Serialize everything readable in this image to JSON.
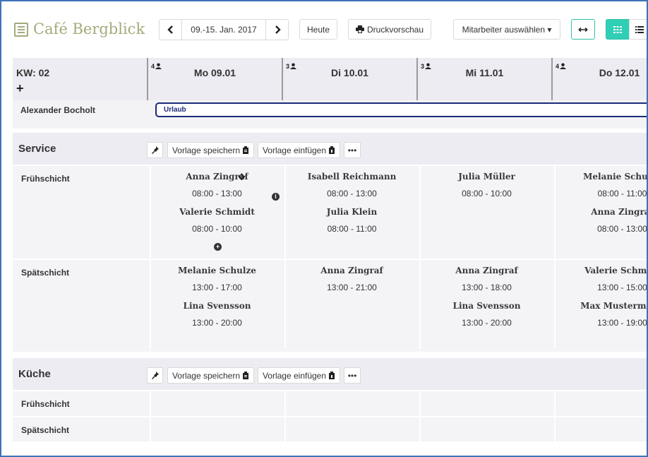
{
  "app": {
    "title": "Café Bergblick"
  },
  "toolbar": {
    "prev_icon": "chevron-left-icon",
    "next_icon": "chevron-right-icon",
    "prev_label": "‹",
    "next_label": "›",
    "date_range": "09.-15. Jan. 2017",
    "today_label": "Heute",
    "print_label": "Druckvorschau",
    "employee_select_label": "Mitarbeiter auswählen ▾",
    "expand_label": "↔",
    "accent_color": "#2fcfb5"
  },
  "calendar": {
    "week_label": "KW: 02",
    "add_label": "+",
    "days": [
      {
        "count": "4",
        "label": "Mo 09.01"
      },
      {
        "count": "3",
        "label": "Di 10.01"
      },
      {
        "count": "3",
        "label": "Mi 11.01"
      },
      {
        "count": "4",
        "label": "Do 12.01"
      }
    ],
    "absence_row": {
      "employee": "Alexander Bocholt",
      "absence": "Urlaub"
    }
  },
  "sections": [
    {
      "title": "Service",
      "buttons": {
        "pin": "📌",
        "save_template": "Vorlage speichern",
        "insert_template": "Vorlage einfügen",
        "more": "•••"
      },
      "shifts": [
        {
          "label": "Frühschicht",
          "days": [
            [
              {
                "name": "Anna Zingraf",
                "time": "08:00  -  13:00"
              },
              {
                "name": "Valerie Schmidt",
                "time": "08:00  -  10:00"
              }
            ],
            [
              {
                "name": "Isabell Reichmann",
                "time": "08:00  -  13:00"
              },
              {
                "name": "Julia Klein",
                "time": "08:00  -  11:00"
              }
            ],
            [
              {
                "name": "Julia Müller",
                "time": "08:00  -  10:00"
              }
            ],
            [
              {
                "name": "Melanie Schulze",
                "time": "08:00  -  11:00"
              },
              {
                "name": "Anna Zingraf",
                "time": "08:00  -  13:00"
              }
            ]
          ]
        },
        {
          "label": "Spätschicht",
          "days": [
            [
              {
                "name": "Melanie Schulze",
                "time": "13:00  -  17:00"
              },
              {
                "name": "Lina Svensson",
                "time": "13:00  -  20:00"
              }
            ],
            [
              {
                "name": "Anna Zingraf",
                "time": "13:00  -  21:00"
              }
            ],
            [
              {
                "name": "Anna Zingraf",
                "time": "13:00  -  18:00"
              },
              {
                "name": "Lina Svensson",
                "time": "13:00  -  20:00"
              }
            ],
            [
              {
                "name": "Valerie Schmidt",
                "time": "13:00  -  15:00"
              },
              {
                "name": "Max Mustermann",
                "time": "13:00  -  19:00"
              }
            ]
          ]
        }
      ]
    },
    {
      "title": "Küche",
      "buttons": {
        "pin": "📌",
        "save_template": "Vorlage speichern",
        "insert_template": "Vorlage einfügen",
        "more": "•••"
      },
      "shifts": [
        {
          "label": "Frühschicht",
          "days": [
            [],
            [],
            [],
            []
          ]
        },
        {
          "label": "Spätschicht",
          "days": [
            [],
            [],
            [],
            []
          ]
        }
      ]
    }
  ]
}
